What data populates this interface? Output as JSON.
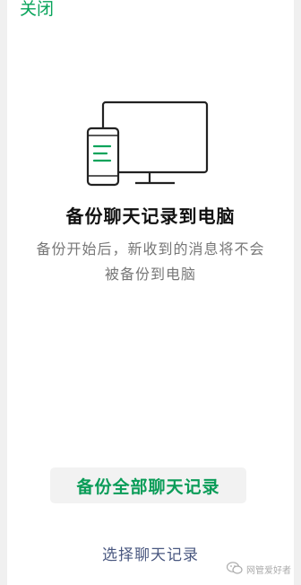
{
  "header": {
    "close_label": "关闭"
  },
  "main": {
    "title": "备份聊天记录到电脑",
    "description": "备份开始后，新收到的消息将不会被备份到电脑"
  },
  "actions": {
    "backup_all_label": "备份全部聊天记录",
    "select_records_label": "选择聊天记录"
  },
  "watermark": {
    "text": "网管爱好者",
    "icon": "wechat-official-account-icon"
  },
  "illustration": {
    "icon": "phone-and-computer-icon"
  },
  "colors": {
    "accent_green": "#07a35a",
    "button_bg": "#f2f2f2",
    "link_color": "#4a5880",
    "description_gray": "#777777"
  }
}
